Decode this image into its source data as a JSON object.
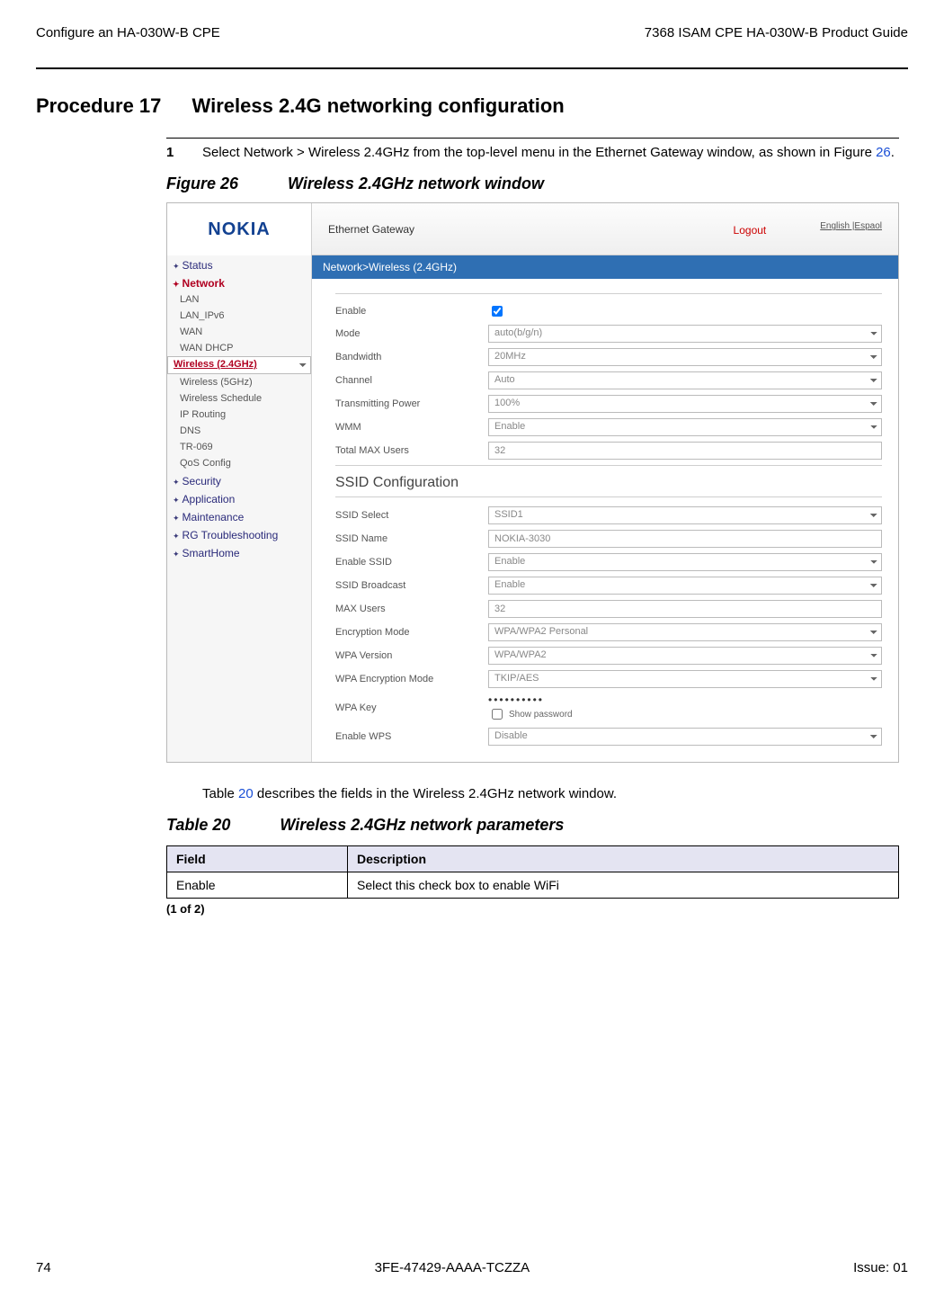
{
  "header": {
    "left": "Configure an HA-030W-B CPE",
    "right": "7368 ISAM CPE HA-030W-B Product Guide"
  },
  "procedure": {
    "number": "Procedure 17",
    "title": "Wireless 2.4G networking configuration"
  },
  "step1": {
    "num": "1",
    "text_pre": "Select Network > Wireless 2.4GHz from the top-level menu in the Ethernet Gateway window, as shown in Figure ",
    "fig_ref": "26",
    "text_post": "."
  },
  "figure": {
    "label": "Figure 26",
    "title": "Wireless 2.4GHz network window"
  },
  "shot": {
    "logo": "NOKIA",
    "topbar_title": "Ethernet Gateway",
    "logout": "Logout",
    "lang": "English |Espaol",
    "breadcrumb": "Network>Wireless (2.4GHz)",
    "side_categories": {
      "status": "Status",
      "network": "Network",
      "security": "Security",
      "application": "Application",
      "maintenance": "Maintenance",
      "rg": "RG Troubleshooting",
      "smarthome": "SmartHome"
    },
    "side_network_items": [
      "LAN",
      "LAN_IPv6",
      "WAN",
      "WAN DHCP",
      "Wireless (2.4GHz)",
      "Wireless (5GHz)",
      "Wireless Schedule",
      "IP Routing",
      "DNS",
      "TR-069",
      "QoS Config"
    ],
    "fields": {
      "enable": "Enable",
      "mode": "Mode",
      "mode_val": "auto(b/g/n)",
      "bandwidth": "Bandwidth",
      "bandwidth_val": "20MHz",
      "channel": "Channel",
      "channel_val": "Auto",
      "txpower": "Transmitting Power",
      "txpower_val": "100%",
      "wmm": "WMM",
      "wmm_val": "Enable",
      "totalmax": "Total MAX Users",
      "totalmax_val": "32"
    },
    "ssid_section": "SSID Configuration",
    "ssid": {
      "select": "SSID Select",
      "select_val": "SSID1",
      "name": "SSID Name",
      "name_val": "NOKIA-3030",
      "enable": "Enable SSID",
      "enable_val": "Enable",
      "broadcast": "SSID Broadcast",
      "broadcast_val": "Enable",
      "max": "MAX Users",
      "max_val": "32",
      "enc": "Encryption Mode",
      "enc_val": "WPA/WPA2 Personal",
      "ver": "WPA Version",
      "ver_val": "WPA/WPA2",
      "encmode": "WPA Encryption Mode",
      "encmode_val": "TKIP/AES",
      "key": "WPA Key",
      "key_val": "••••••••••",
      "showpw": "Show password",
      "wps": "Enable WPS",
      "wps_val": "Disable"
    }
  },
  "table_intro_pre": "Table ",
  "table_intro_ref": "20",
  "table_intro_post": " describes the fields in the Wireless 2.4GHz network window.",
  "table": {
    "label": "Table 20",
    "title": "Wireless 2.4GHz network parameters",
    "h_field": "Field",
    "h_desc": "Description",
    "rows": [
      {
        "field": "Enable",
        "desc": "Select this check box to enable WiFi"
      }
    ],
    "page_note": "(1 of 2)"
  },
  "footer": {
    "page": "74",
    "doc": "3FE-47429-AAAA-TCZZA",
    "issue": "Issue: 01"
  }
}
